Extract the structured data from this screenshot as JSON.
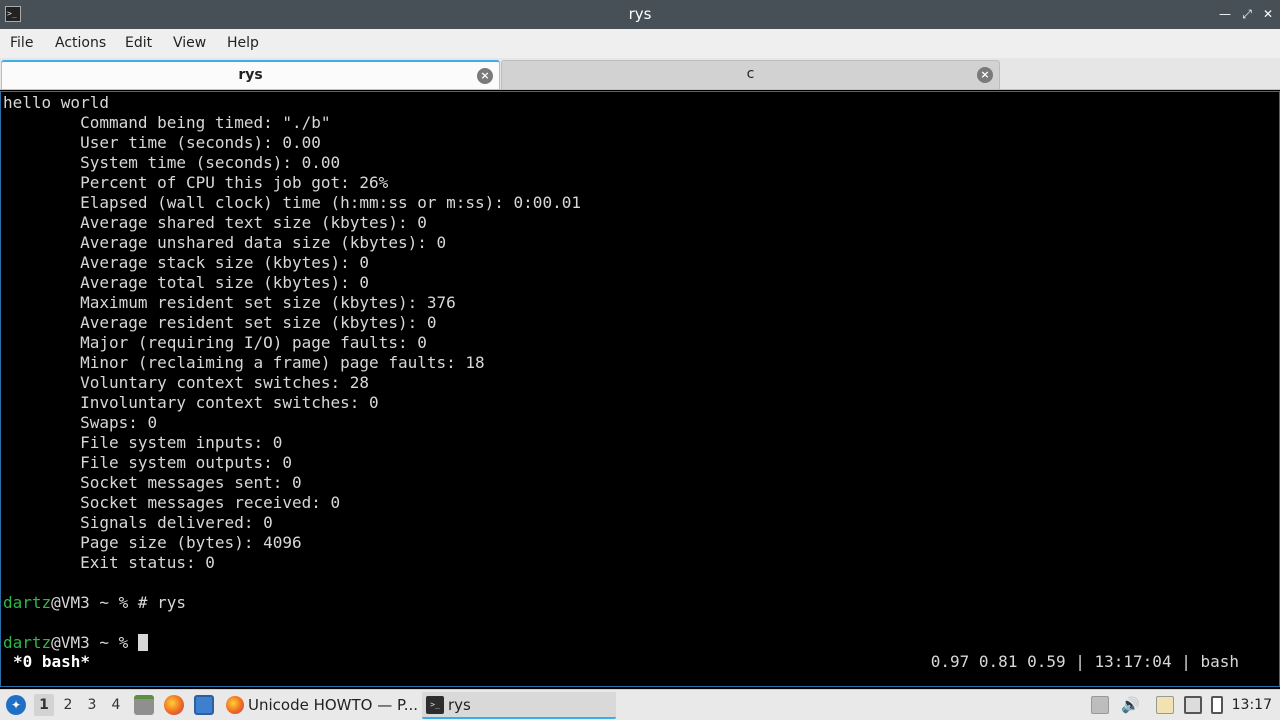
{
  "window": {
    "title": "rys",
    "app_icon_name": "terminal-icon",
    "buttons": [
      "minimize",
      "restore",
      "close"
    ]
  },
  "menubar": {
    "items": [
      "File",
      "Actions",
      "Edit",
      "View",
      "Help"
    ]
  },
  "tabs": [
    {
      "label": "rys",
      "active": true
    },
    {
      "label": "c",
      "active": false
    }
  ],
  "terminal": {
    "lines": [
      "hello world",
      "        Command being timed: \"./b\"",
      "        User time (seconds): 0.00",
      "        System time (seconds): 0.00",
      "        Percent of CPU this job got: 26%",
      "        Elapsed (wall clock) time (h:mm:ss or m:ss): 0:00.01",
      "        Average shared text size (kbytes): 0",
      "        Average unshared data size (kbytes): 0",
      "        Average stack size (kbytes): 0",
      "        Average total size (kbytes): 0",
      "        Maximum resident set size (kbytes): 376",
      "        Average resident set size (kbytes): 0",
      "        Major (requiring I/O) page faults: 0",
      "        Minor (reclaiming a frame) page faults: 18",
      "        Voluntary context switches: 28",
      "        Involuntary context switches: 0",
      "        Swaps: 0",
      "        File system inputs: 0",
      "        File system outputs: 0",
      "        Socket messages sent: 0",
      "        Socket messages received: 0",
      "        Signals delivered: 0",
      "        Page size (bytes): 4096",
      "        Exit status: 0",
      ""
    ],
    "prompt1": {
      "user": "dartz",
      "host": "@VM3 ~ % ",
      "command": "# rys"
    },
    "blank": "",
    "prompt2": {
      "user": "dartz",
      "host": "@VM3 ~ % ",
      "command": ""
    },
    "status_left": "*0 bash*",
    "status_right": "0.97 0.81 0.59 | 13:17:04 | bash",
    "colors": {
      "background": "#000000",
      "text": "#d8d8d8",
      "prompt_user": "#2fb84a"
    }
  },
  "taskbar": {
    "desktops": [
      "1",
      "2",
      "3",
      "4"
    ],
    "active_desktop": "1",
    "launchers": [
      "file-manager-icon",
      "firefox-icon",
      "desktop-icon"
    ],
    "tasks": [
      {
        "label": "Unicode HOWTO — P...",
        "icon": "firefox-icon",
        "active": false
      },
      {
        "label": "rys",
        "icon": "terminal-icon",
        "active": true
      }
    ],
    "tray": [
      "tray-up-icon",
      "volume-icon",
      "clipboard-icon",
      "network-icon",
      "battery-icon"
    ],
    "clock": "13:17"
  }
}
